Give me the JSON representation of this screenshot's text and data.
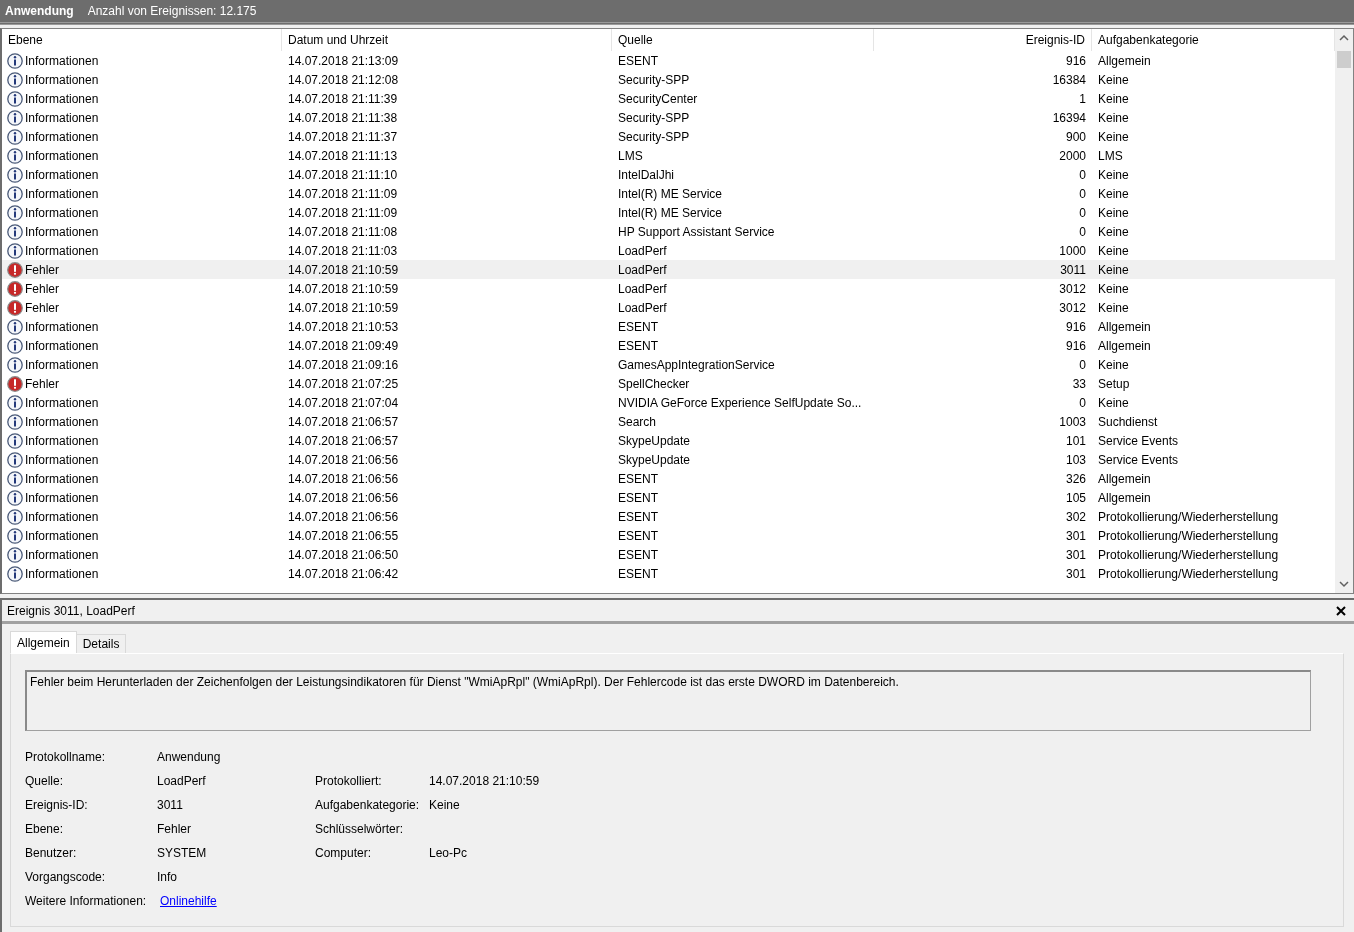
{
  "title_bar": {
    "log_name": "Anwendung",
    "count": "Anzahl von Ereignissen: 12.175"
  },
  "table": {
    "columns": [
      "Ebene",
      "Datum und Uhrzeit",
      "Quelle",
      "Ereignis-ID",
      "Aufgabenkategorie"
    ],
    "rows": [
      {
        "kind": "information",
        "level": "Informationen",
        "date": "14.07.2018 21:13:09",
        "source": "ESENT",
        "id": "916",
        "category": "Allgemein",
        "selected": false
      },
      {
        "kind": "information",
        "level": "Informationen",
        "date": "14.07.2018 21:12:08",
        "source": "Security-SPP",
        "id": "16384",
        "category": "Keine",
        "selected": false
      },
      {
        "kind": "information",
        "level": "Informationen",
        "date": "14.07.2018 21:11:39",
        "source": "SecurityCenter",
        "id": "1",
        "category": "Keine",
        "selected": false
      },
      {
        "kind": "information",
        "level": "Informationen",
        "date": "14.07.2018 21:11:38",
        "source": "Security-SPP",
        "id": "16394",
        "category": "Keine",
        "selected": false
      },
      {
        "kind": "information",
        "level": "Informationen",
        "date": "14.07.2018 21:11:37",
        "source": "Security-SPP",
        "id": "900",
        "category": "Keine",
        "selected": false
      },
      {
        "kind": "information",
        "level": "Informationen",
        "date": "14.07.2018 21:11:13",
        "source": "LMS",
        "id": "2000",
        "category": "LMS",
        "selected": false
      },
      {
        "kind": "information",
        "level": "Informationen",
        "date": "14.07.2018 21:11:10",
        "source": "IntelDalJhi",
        "id": "0",
        "category": "Keine",
        "selected": false
      },
      {
        "kind": "information",
        "level": "Informationen",
        "date": "14.07.2018 21:11:09",
        "source": "Intel(R) ME Service",
        "id": "0",
        "category": "Keine",
        "selected": false
      },
      {
        "kind": "information",
        "level": "Informationen",
        "date": "14.07.2018 21:11:09",
        "source": "Intel(R) ME Service",
        "id": "0",
        "category": "Keine",
        "selected": false
      },
      {
        "kind": "information",
        "level": "Informationen",
        "date": "14.07.2018 21:11:08",
        "source": "HP Support Assistant Service",
        "id": "0",
        "category": "Keine",
        "selected": false
      },
      {
        "kind": "information",
        "level": "Informationen",
        "date": "14.07.2018 21:11:03",
        "source": "LoadPerf",
        "id": "1000",
        "category": "Keine",
        "selected": false
      },
      {
        "kind": "error",
        "level": "Fehler",
        "date": "14.07.2018 21:10:59",
        "source": "LoadPerf",
        "id": "3011",
        "category": "Keine",
        "selected": true
      },
      {
        "kind": "error",
        "level": "Fehler",
        "date": "14.07.2018 21:10:59",
        "source": "LoadPerf",
        "id": "3012",
        "category": "Keine",
        "selected": false
      },
      {
        "kind": "error",
        "level": "Fehler",
        "date": "14.07.2018 21:10:59",
        "source": "LoadPerf",
        "id": "3012",
        "category": "Keine",
        "selected": false
      },
      {
        "kind": "information",
        "level": "Informationen",
        "date": "14.07.2018 21:10:53",
        "source": "ESENT",
        "id": "916",
        "category": "Allgemein",
        "selected": false
      },
      {
        "kind": "information",
        "level": "Informationen",
        "date": "14.07.2018 21:09:49",
        "source": "ESENT",
        "id": "916",
        "category": "Allgemein",
        "selected": false
      },
      {
        "kind": "information",
        "level": "Informationen",
        "date": "14.07.2018 21:09:16",
        "source": "GamesAppIntegrationService",
        "id": "0",
        "category": "Keine",
        "selected": false
      },
      {
        "kind": "error",
        "level": "Fehler",
        "date": "14.07.2018 21:07:25",
        "source": "SpellChecker",
        "id": "33",
        "category": "Setup",
        "selected": false
      },
      {
        "kind": "information",
        "level": "Informationen",
        "date": "14.07.2018 21:07:04",
        "source": "NVIDIA GeForce Experience SelfUpdate So...",
        "id": "0",
        "category": "Keine",
        "selected": false
      },
      {
        "kind": "information",
        "level": "Informationen",
        "date": "14.07.2018 21:06:57",
        "source": "Search",
        "id": "1003",
        "category": "Suchdienst",
        "selected": false
      },
      {
        "kind": "information",
        "level": "Informationen",
        "date": "14.07.2018 21:06:57",
        "source": "SkypeUpdate",
        "id": "101",
        "category": "Service Events",
        "selected": false
      },
      {
        "kind": "information",
        "level": "Informationen",
        "date": "14.07.2018 21:06:56",
        "source": "SkypeUpdate",
        "id": "103",
        "category": "Service Events",
        "selected": false
      },
      {
        "kind": "information",
        "level": "Informationen",
        "date": "14.07.2018 21:06:56",
        "source": "ESENT",
        "id": "326",
        "category": "Allgemein",
        "selected": false
      },
      {
        "kind": "information",
        "level": "Informationen",
        "date": "14.07.2018 21:06:56",
        "source": "ESENT",
        "id": "105",
        "category": "Allgemein",
        "selected": false
      },
      {
        "kind": "information",
        "level": "Informationen",
        "date": "14.07.2018 21:06:56",
        "source": "ESENT",
        "id": "302",
        "category": "Protokollierung/Wiederherstellung",
        "selected": false
      },
      {
        "kind": "information",
        "level": "Informationen",
        "date": "14.07.2018 21:06:55",
        "source": "ESENT",
        "id": "301",
        "category": "Protokollierung/Wiederherstellung",
        "selected": false
      },
      {
        "kind": "information",
        "level": "Informationen",
        "date": "14.07.2018 21:06:50",
        "source": "ESENT",
        "id": "301",
        "category": "Protokollierung/Wiederherstellung",
        "selected": false
      },
      {
        "kind": "information",
        "level": "Informationen",
        "date": "14.07.2018 21:06:42",
        "source": "ESENT",
        "id": "301",
        "category": "Protokollierung/Wiederherstellung",
        "selected": false
      }
    ]
  },
  "detail": {
    "title": "Ereignis 3011, LoadPerf",
    "tabs": [
      {
        "label": "Allgemein",
        "selected": true
      },
      {
        "label": "Details",
        "selected": false
      }
    ],
    "description": "Fehler beim Herunterladen der Zeichenfolgen der Leistungsindikatoren für Dienst \"WmiApRpl\" (WmiApRpl). Der Fehlercode ist das erste DWORD im Datenbereich.",
    "rows": [
      [
        {
          "label": "Protokollname:",
          "value": "Anwendung"
        }
      ],
      [
        {
          "label": "Quelle:",
          "value": "LoadPerf"
        },
        {
          "label": "Protokolliert:",
          "value": "14.07.2018 21:10:59"
        }
      ],
      [
        {
          "label": "Ereignis-ID:",
          "value": "3011"
        },
        {
          "label": "Aufgabenkategorie:",
          "value": "Keine"
        }
      ],
      [
        {
          "label": "Ebene:",
          "value": "Fehler"
        },
        {
          "label": "Schlüsselwörter:"
        }
      ],
      [
        {
          "label": "Benutzer:",
          "value": "SYSTEM"
        },
        {
          "label": "Computer:",
          "value": "Leo-Pc"
        }
      ],
      [
        {
          "label": "Vorgangscode:",
          "value": "Info"
        }
      ],
      [
        {
          "label": "Weitere Informationen:",
          "value": "Onlinehilfe",
          "kind": "link"
        }
      ]
    ]
  }
}
